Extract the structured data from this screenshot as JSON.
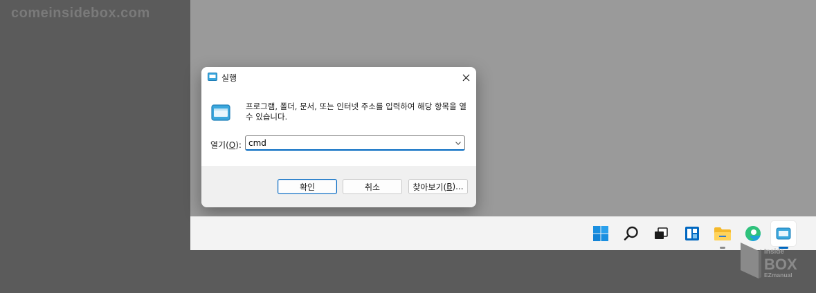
{
  "watermark": "comeinsidebox.com",
  "dialog": {
    "title": "실행",
    "description": "프로그램, 폴더, 문서, 또는 인터넷 주소를 입력하여 해당 항목을 열 수 있습니다.",
    "open_label_prefix": "열기(",
    "open_label_key": "O",
    "open_label_suffix": "):",
    "open_value": "cmd",
    "ok_label": "확인",
    "cancel_label": "취소",
    "browse_label_prefix": "찾아보기(",
    "browse_label_key": "B",
    "browse_label_suffix": ")..."
  },
  "taskbar": {
    "items": [
      "windows-start",
      "search",
      "task-view",
      "widgets",
      "file-explorer",
      "edge",
      "run"
    ]
  },
  "logo": {
    "line1": "Inside",
    "line2": "BOX",
    "line3": "EZmanual"
  },
  "colors": {
    "accent": "#0067c0",
    "desktop": "#9a9a9a",
    "background": "#5b5b5b",
    "taskbar": "#f3f3f3"
  }
}
